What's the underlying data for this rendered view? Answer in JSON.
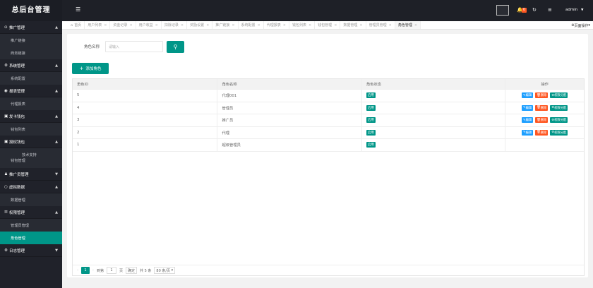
{
  "sidebar": {
    "title": "总后台管理",
    "groups": [
      {
        "label": "推广管理",
        "icon": "check-circle-icon",
        "open": true,
        "items": [
          "推广链接",
          "商务链接"
        ]
      },
      {
        "label": "系统管理",
        "icon": "gear-icon",
        "open": true,
        "items": [
          "系统配置"
        ]
      },
      {
        "label": "报表管理",
        "icon": "target-icon",
        "open": true,
        "items": [
          "代理报表"
        ]
      },
      {
        "label": "发卡钱包",
        "icon": "wallet-icon",
        "open": true,
        "items": [
          "钱包列表"
        ]
      },
      {
        "label": "授权钱包",
        "icon": "wallet-icon",
        "open": true,
        "items": [
          "技术支持",
          "钱包管理"
        ]
      },
      {
        "label": "推广员管理",
        "icon": "user-icon",
        "open": false,
        "items": []
      },
      {
        "label": "虚拟数据",
        "icon": "circle-icon",
        "open": true,
        "items": [
          "数据管理"
        ]
      },
      {
        "label": "权限管理",
        "icon": "list-icon",
        "open": true,
        "items": [
          "管理员管理",
          "角色管理"
        ]
      },
      {
        "label": "日志管理",
        "icon": "gear-icon",
        "open": false,
        "items": []
      }
    ],
    "active_item": "角色管理"
  },
  "topbar": {
    "menu_icon": "menu-fold-icon",
    "badge": "0",
    "user": "admin"
  },
  "tabs": [
    "首页",
    "用户列表",
    "资金记录",
    "用户收益",
    "扣除记录",
    "奖励设置",
    "推广链接",
    "系统配置",
    "代理报表",
    "钱包列表",
    "钱包管理",
    "数据管理",
    "管理员管理",
    "角色管理"
  ],
  "tab_active": "角色管理",
  "tab_ops": "页面操作",
  "search": {
    "label": "角色名称",
    "placeholder": "请输入"
  },
  "add_button": "添加角色",
  "table": {
    "headers": [
      "角色ID",
      "角色名称",
      "角色状态",
      "操作"
    ],
    "rows": [
      {
        "id": "5",
        "name": "代理001",
        "status": "启用",
        "ops": true
      },
      {
        "id": "4",
        "name": "管理员",
        "status": "启用",
        "ops": true
      },
      {
        "id": "3",
        "name": "推广员",
        "status": "启用",
        "ops": true
      },
      {
        "id": "2",
        "name": "代理",
        "status": "启用",
        "ops": true
      },
      {
        "id": "1",
        "name": "超级管理员",
        "status": "启用",
        "ops": false
      }
    ],
    "op_edit": "编辑",
    "op_delete": "删除",
    "op_perm": "权限分配"
  },
  "pager": {
    "current": "1",
    "goto_label": "到第",
    "page_input": "1",
    "page_suffix": "页",
    "confirm": "确定",
    "total": "共 5 条",
    "per_page": "80 条/页"
  }
}
